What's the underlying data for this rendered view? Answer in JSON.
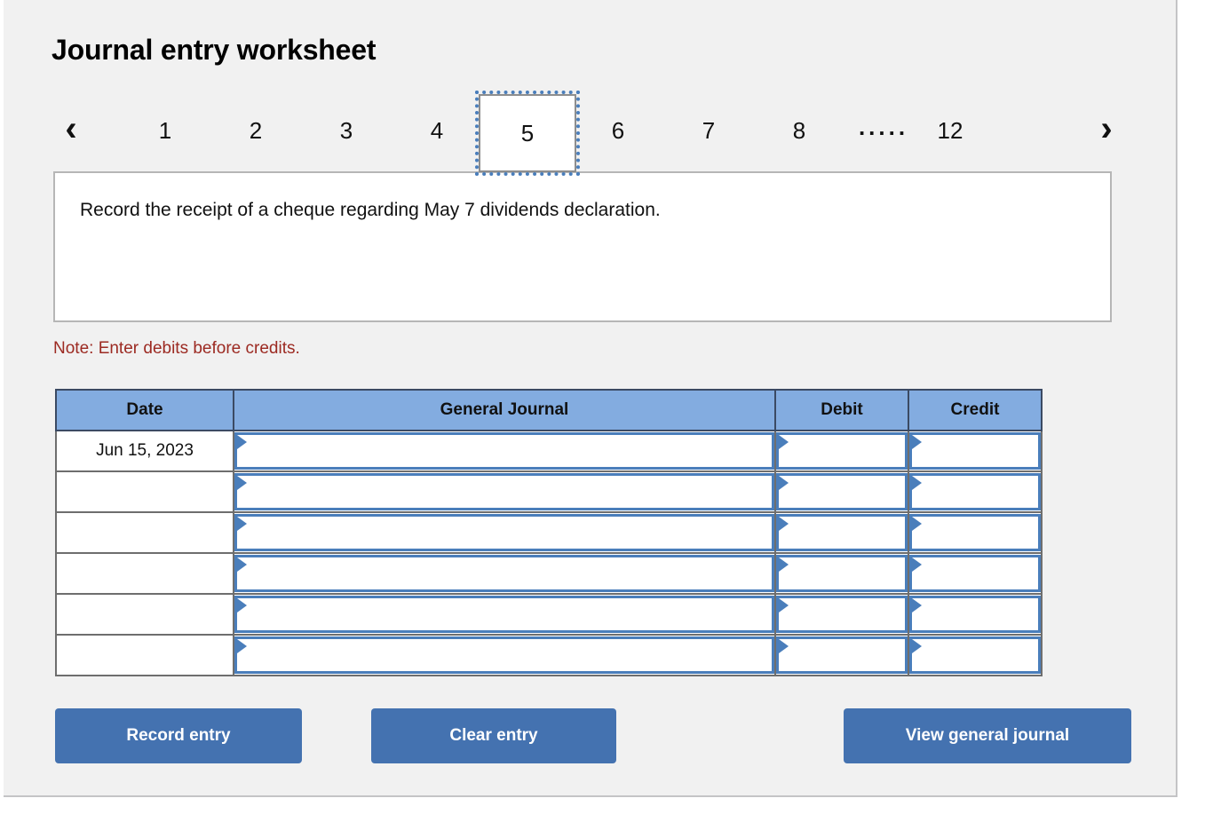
{
  "page": {
    "title": "Journal entry worksheet"
  },
  "pager": {
    "prev_icon": "chevron-left-icon",
    "next_icon": "chevron-right-icon",
    "pages": [
      "1",
      "2",
      "3",
      "4",
      "5",
      "6",
      "7",
      "8"
    ],
    "ellipsis": ".....",
    "last_page": "12",
    "active_page": "5"
  },
  "instruction": {
    "text": "Record the receipt of a cheque regarding May 7 dividends declaration."
  },
  "note": {
    "text": "Note: Enter debits before credits."
  },
  "table": {
    "headers": {
      "date": "Date",
      "general_journal": "General Journal",
      "debit": "Debit",
      "credit": "Credit"
    },
    "rows": [
      {
        "date": "Jun 15, 2023",
        "general_journal": "",
        "debit": "",
        "credit": ""
      },
      {
        "date": "",
        "general_journal": "",
        "debit": "",
        "credit": ""
      },
      {
        "date": "",
        "general_journal": "",
        "debit": "",
        "credit": ""
      },
      {
        "date": "",
        "general_journal": "",
        "debit": "",
        "credit": ""
      },
      {
        "date": "",
        "general_journal": "",
        "debit": "",
        "credit": ""
      },
      {
        "date": "",
        "general_journal": "",
        "debit": "",
        "credit": ""
      }
    ]
  },
  "buttons": {
    "record": "Record entry",
    "clear": "Clear entry",
    "view": "View general journal"
  },
  "colors": {
    "panel_bg": "#f1f1f1",
    "header_blue": "#83ace0",
    "button_blue": "#4472b0",
    "note_red": "#9c2a22",
    "input_border_blue": "#4a7ebb"
  }
}
